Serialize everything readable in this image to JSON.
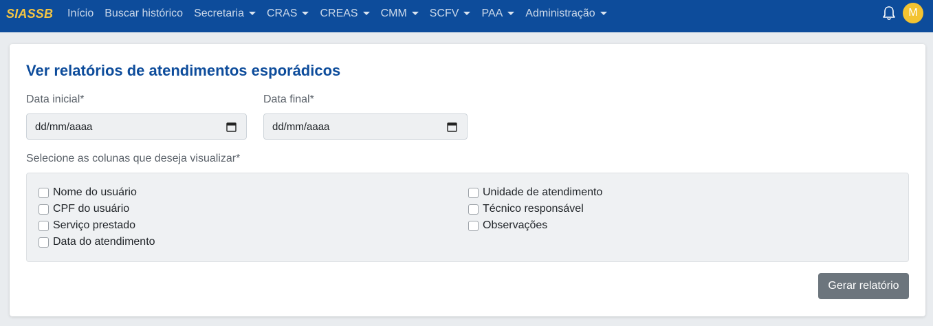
{
  "navbar": {
    "brand": "SIASSB",
    "items": [
      {
        "label": "Início",
        "dropdown": false
      },
      {
        "label": "Buscar histórico",
        "dropdown": false
      },
      {
        "label": "Secretaria",
        "dropdown": true
      },
      {
        "label": "CRAS",
        "dropdown": true
      },
      {
        "label": "CREAS",
        "dropdown": true
      },
      {
        "label": "CMM",
        "dropdown": true
      },
      {
        "label": "SCFV",
        "dropdown": true
      },
      {
        "label": "PAA",
        "dropdown": true
      },
      {
        "label": "Administração",
        "dropdown": true
      }
    ],
    "notification_icon": "bell-icon",
    "avatar_initial": "M",
    "colors": {
      "background": "#0d4c9b",
      "brand": "#f5c542",
      "avatar": "#f3c331"
    }
  },
  "main": {
    "title": "Ver relatórios de atendimentos esporádicos",
    "start_date": {
      "label": "Data inicial*",
      "placeholder": "dd/mm/aaaa",
      "icon": "calendar-icon"
    },
    "end_date": {
      "label": "Data final*",
      "placeholder": "dd/mm/aaaa",
      "icon": "calendar-icon"
    },
    "columns_label": "Selecione as colunas que deseja visualizar*",
    "columns_left": [
      {
        "label": "Nome do usuário",
        "checked": false
      },
      {
        "label": "CPF do usuário",
        "checked": false
      },
      {
        "label": "Serviço prestado",
        "checked": false
      },
      {
        "label": "Data do atendimento",
        "checked": false
      }
    ],
    "columns_right": [
      {
        "label": "Unidade de atendimento",
        "checked": false
      },
      {
        "label": "Técnico responsável",
        "checked": false
      },
      {
        "label": "Observações",
        "checked": false
      }
    ],
    "generate_button": "Gerar relatório",
    "colors": {
      "title": "#0d4c9b",
      "button": "#6c757d"
    }
  }
}
